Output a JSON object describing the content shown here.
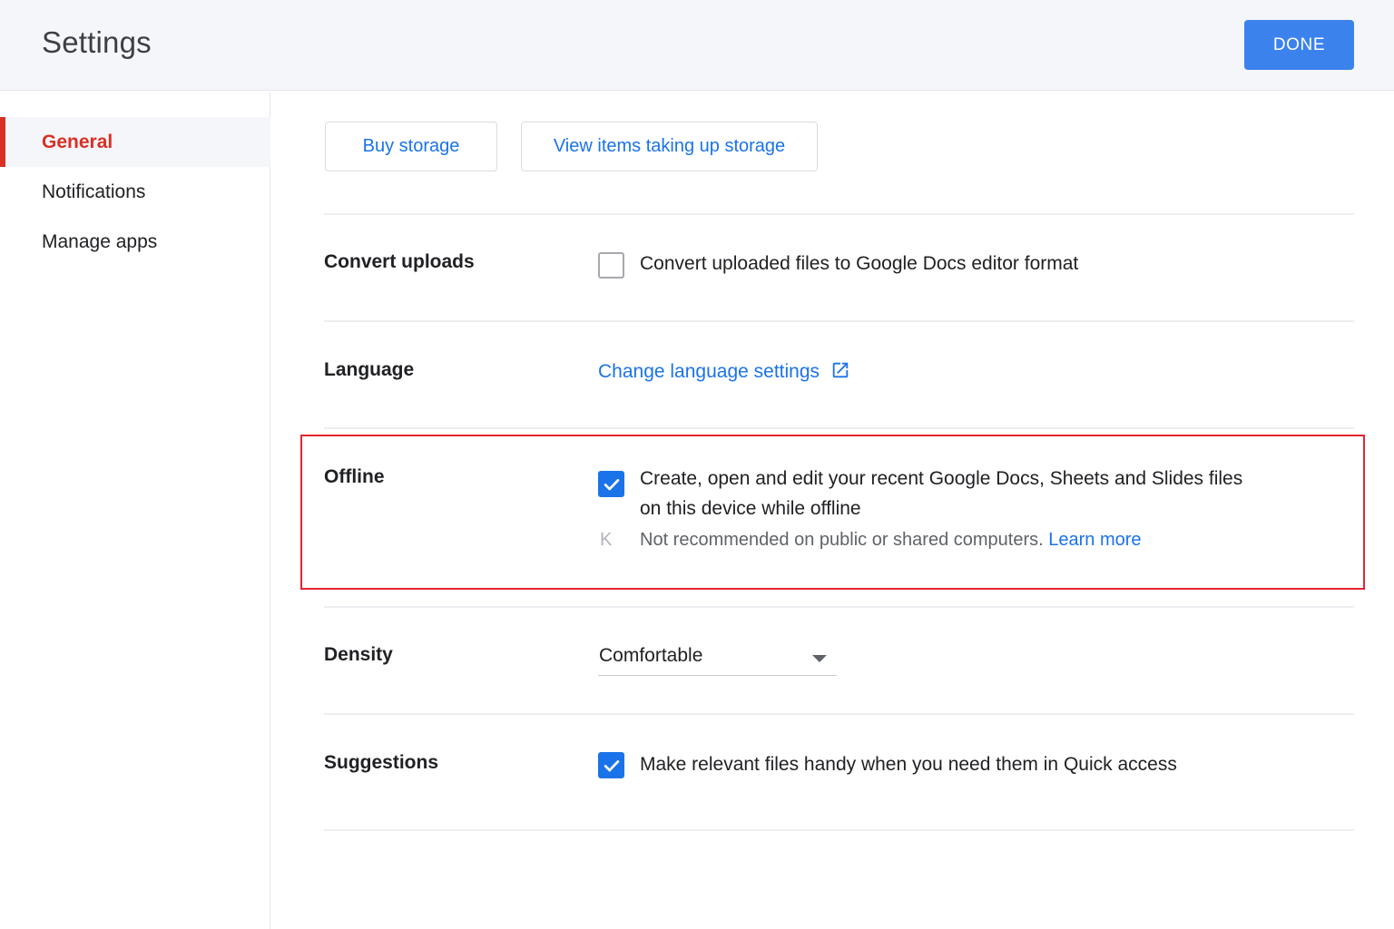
{
  "header": {
    "title": "Settings",
    "done_label": "DONE"
  },
  "sidebar": {
    "items": [
      {
        "label": "General",
        "active": true
      },
      {
        "label": "Notifications",
        "active": false
      },
      {
        "label": "Manage apps",
        "active": false
      }
    ]
  },
  "storage": {
    "buy_label": "Buy storage",
    "view_label": "View items taking up storage"
  },
  "convert_uploads": {
    "label": "Convert uploads",
    "checked": false,
    "text": "Convert uploaded files to Google Docs editor format"
  },
  "language": {
    "label": "Language",
    "link": "Change language settings",
    "icon": "open-in-new-icon"
  },
  "offline": {
    "label": "Offline",
    "checked": true,
    "text_line1": "Create, open and edit your recent Google Docs, Sheets and Slides files",
    "text_line2": "on this device while offline",
    "note": "Not recommended on public or shared computers.",
    "learn_more": "Learn more",
    "note_icon": "K"
  },
  "density": {
    "label": "Density",
    "value": "Comfortable"
  },
  "suggestions": {
    "label": "Suggestions",
    "checked": true,
    "text": "Make relevant files handy when you need them in Quick access"
  },
  "colors": {
    "accent": "#1a73e8",
    "active_nav": "#d93025",
    "done_button": "#3b82ed",
    "highlight_border": "#e3262e"
  }
}
